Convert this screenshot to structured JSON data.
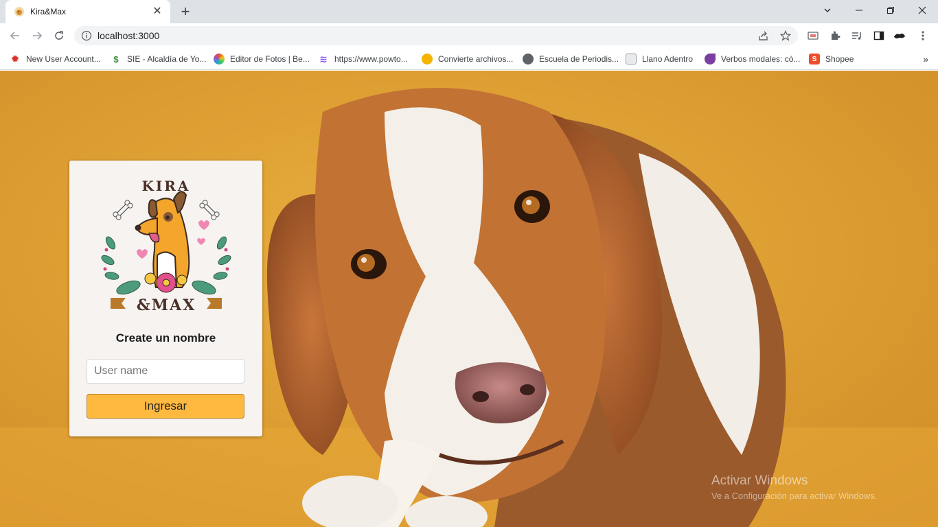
{
  "browser": {
    "tab": {
      "title": "Kira&Max"
    },
    "address": {
      "url": "localhost:3000"
    },
    "bookmarks": [
      {
        "label": "New User Account...",
        "icon": "settings-icon",
        "color": "#d93025"
      },
      {
        "label": "SIE - Alcaldía de Yo...",
        "icon": "s-logo-icon",
        "color": "#3b8d3b"
      },
      {
        "label": "Editor de Fotos | Be...",
        "icon": "befunky-icon",
        "color": "#7b3fe4"
      },
      {
        "label": "https://www.powto...",
        "icon": "powtoon-icon",
        "color": "#8a5cf6"
      },
      {
        "label": "Convierte archivos...",
        "icon": "convertio-icon",
        "color": "#f4b400"
      },
      {
        "label": "Escuela de Periodis...",
        "icon": "globe-icon",
        "color": "#5f6368"
      },
      {
        "label": "Llano Adentro",
        "icon": "document-icon",
        "color": "#9aa0a6"
      },
      {
        "label": "Verbos modales: có...",
        "icon": "leaf-icon",
        "color": "#7a3ea0"
      },
      {
        "label": "Shopee",
        "icon": "shopee-icon",
        "color": "#ee4d2d"
      }
    ]
  },
  "login": {
    "heading": "Create un nombre",
    "username_placeholder": "User name",
    "submit_label": "Ingresar",
    "logo_text_top": "KIRA",
    "logo_text_bottom": "&MAX"
  },
  "os_watermark": {
    "title": "Activar Windows",
    "subtitle": "Ve a Configuración para activar Windows."
  },
  "colors": {
    "accent_button": "#ffb940",
    "background": "#e0a233"
  }
}
